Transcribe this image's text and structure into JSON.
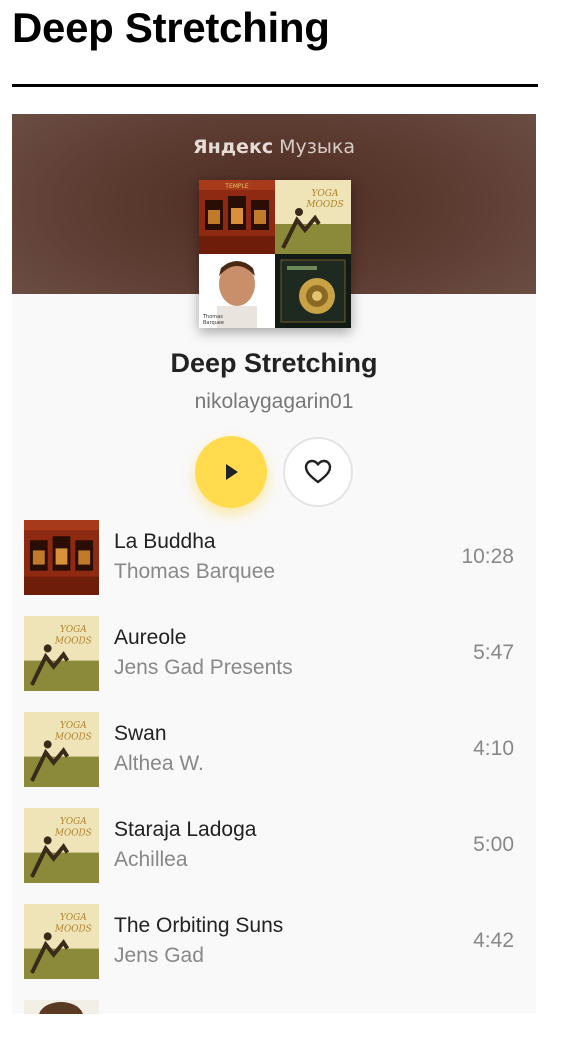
{
  "page": {
    "title": "Deep Stretching"
  },
  "widget": {
    "brand_main": "Яндекс",
    "brand_sub": "Музыка",
    "playlist_title": "Deep Stretching",
    "owner": "nikolaygagarin01",
    "cover_icons": [
      "temple-album-cover",
      "yoga-moods-album-cover",
      "portrait-album-cover",
      "shell-album-cover"
    ],
    "cover_text": {
      "temple": "TEMPLE",
      "yoga": "YOGA MOODS",
      "portrait": "Thomas Barquee"
    }
  },
  "tracks": [
    {
      "name": "La Buddha",
      "artist": "Thomas Barquee",
      "duration": "10:28",
      "cover": "temple"
    },
    {
      "name": "Aureole",
      "artist": "Jens Gad Presents",
      "duration": "5:47",
      "cover": "yoga"
    },
    {
      "name": "Swan",
      "artist": "Althea W.",
      "duration": "4:10",
      "cover": "yoga"
    },
    {
      "name": "Staraja Ladoga",
      "artist": "Achillea",
      "duration": "5:00",
      "cover": "yoga"
    },
    {
      "name": "The Orbiting Suns",
      "artist": "Jens Gad",
      "duration": "4:42",
      "cover": "yoga"
    }
  ],
  "colors": {
    "play": "#ffdb4d",
    "banner": "#5b3a30",
    "text_muted": "#888888"
  }
}
